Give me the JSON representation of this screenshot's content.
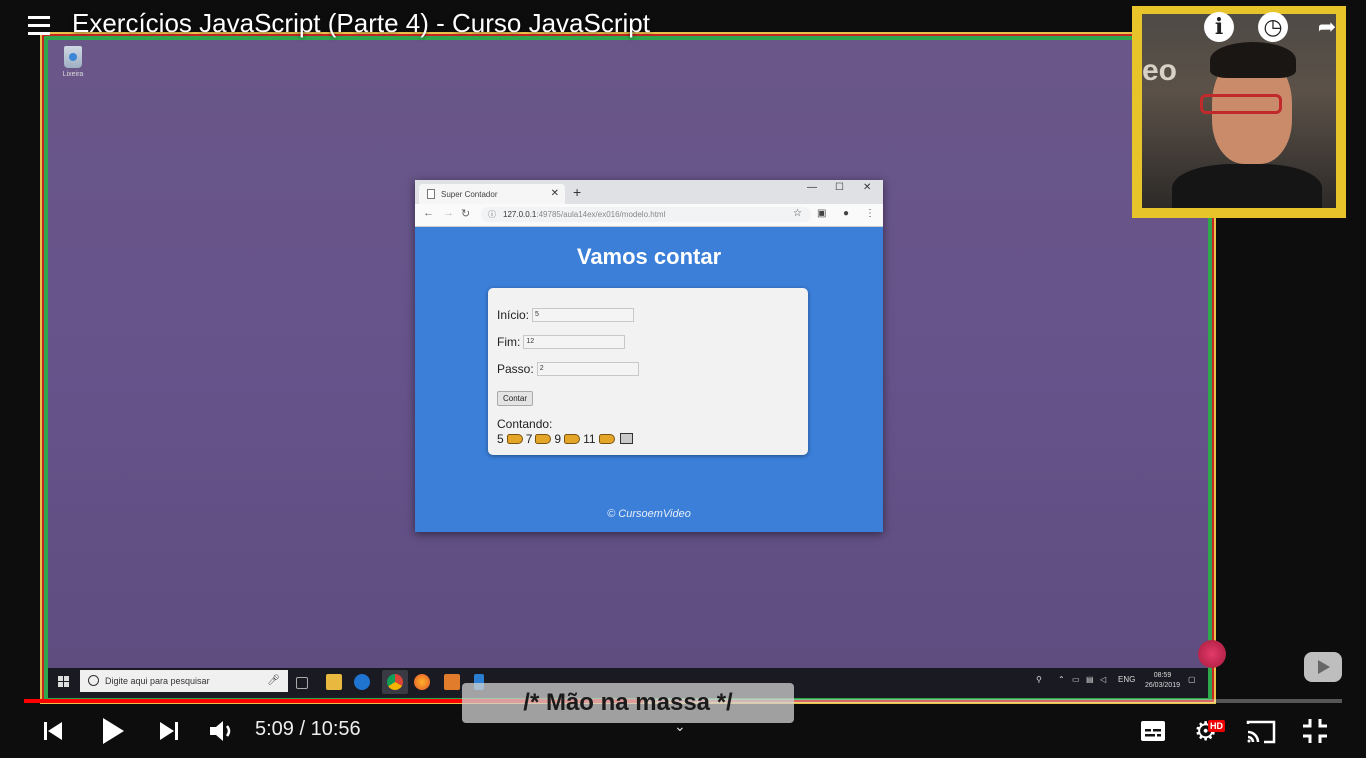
{
  "player": {
    "title": "Exercícios JavaScript (Parte 4) - Curso JavaScript",
    "time_current": "5:09",
    "time_sep": " / ",
    "time_total": "10:56",
    "progress": 0.47,
    "caption": "/* Mão na massa */",
    "hd_badge": "HD",
    "icons": [
      "menu-icon",
      "info-icon",
      "watch-later-icon",
      "share-icon",
      "skip-previous-icon",
      "play-icon",
      "skip-next-icon",
      "volume-icon",
      "subtitles-icon",
      "settings-icon",
      "cast-icon",
      "exit-fullscreen-icon",
      "chevron-down-icon"
    ]
  },
  "desktop": {
    "recycle_label": "Lixeira"
  },
  "browser": {
    "tab_title": "Super Contador",
    "url_host": "127.0.0.1",
    "url_rest": ":49785/aula14ex/ex016/modelo.html",
    "page": {
      "heading": "Vamos contar",
      "inicio_label": "Início:",
      "inicio_value": "5",
      "fim_label": "Fim:",
      "fim_value": "12",
      "passo_label": "Passo:",
      "passo_value": "2",
      "button_label": "Contar",
      "result_label": "Contando:",
      "result_numbers": [
        "5",
        "7",
        "9",
        "11"
      ],
      "footer": "© CursoemVideo"
    }
  },
  "taskbar": {
    "search_placeholder": "Digite aqui para pesquisar",
    "lang": "ENG",
    "time": "08:59",
    "date": "26/03/2019"
  },
  "colors": {
    "page_bg": "#3b7fd9",
    "desktop_bg": "#66538a",
    "pip_frame": "#e7c52a",
    "progress": "#ff0000"
  }
}
